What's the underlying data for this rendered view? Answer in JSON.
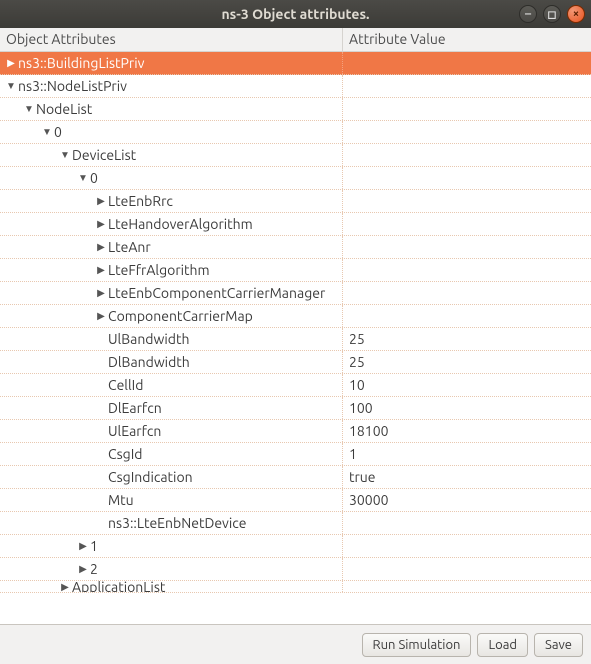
{
  "window": {
    "title": "ns-3 Object attributes."
  },
  "headers": {
    "left": "Object Attributes",
    "right": "Attribute Value"
  },
  "rows": [
    {
      "indent": 0,
      "arrow": "right",
      "label": "ns3::BuildingListPriv",
      "value": "",
      "selected": true
    },
    {
      "indent": 0,
      "arrow": "down",
      "label": "ns3::NodeListPriv",
      "value": ""
    },
    {
      "indent": 1,
      "arrow": "down",
      "label": "NodeList",
      "value": ""
    },
    {
      "indent": 2,
      "arrow": "down",
      "label": "0",
      "value": ""
    },
    {
      "indent": 3,
      "arrow": "down",
      "label": "DeviceList",
      "value": ""
    },
    {
      "indent": 4,
      "arrow": "down",
      "label": "0",
      "value": ""
    },
    {
      "indent": 5,
      "arrow": "right",
      "label": "LteEnbRrc",
      "value": ""
    },
    {
      "indent": 5,
      "arrow": "right",
      "label": "LteHandoverAlgorithm",
      "value": ""
    },
    {
      "indent": 5,
      "arrow": "right",
      "label": "LteAnr",
      "value": ""
    },
    {
      "indent": 5,
      "arrow": "right",
      "label": "LteFfrAlgorithm",
      "value": ""
    },
    {
      "indent": 5,
      "arrow": "right",
      "label": "LteEnbComponentCarrierManager",
      "value": ""
    },
    {
      "indent": 5,
      "arrow": "right",
      "label": "ComponentCarrierMap",
      "value": ""
    },
    {
      "indent": 5,
      "arrow": "",
      "label": "UlBandwidth",
      "value": "25"
    },
    {
      "indent": 5,
      "arrow": "",
      "label": "DlBandwidth",
      "value": "25"
    },
    {
      "indent": 5,
      "arrow": "",
      "label": "CellId",
      "value": "10"
    },
    {
      "indent": 5,
      "arrow": "",
      "label": "DlEarfcn",
      "value": "100"
    },
    {
      "indent": 5,
      "arrow": "",
      "label": "UlEarfcn",
      "value": "18100"
    },
    {
      "indent": 5,
      "arrow": "",
      "label": "CsgId",
      "value": "1"
    },
    {
      "indent": 5,
      "arrow": "",
      "label": "CsgIndication",
      "value": "true"
    },
    {
      "indent": 5,
      "arrow": "",
      "label": "Mtu",
      "value": "30000"
    },
    {
      "indent": 5,
      "arrow": "",
      "label": "ns3::LteEnbNetDevice",
      "value": ""
    },
    {
      "indent": 4,
      "arrow": "right",
      "label": "1",
      "value": ""
    },
    {
      "indent": 4,
      "arrow": "right",
      "label": "2",
      "value": ""
    },
    {
      "indent": 3,
      "arrow": "right",
      "label": "ApplicationList",
      "value": "",
      "partial": true
    }
  ],
  "footer": {
    "run": "Run Simulation",
    "load": "Load",
    "save": "Save"
  }
}
